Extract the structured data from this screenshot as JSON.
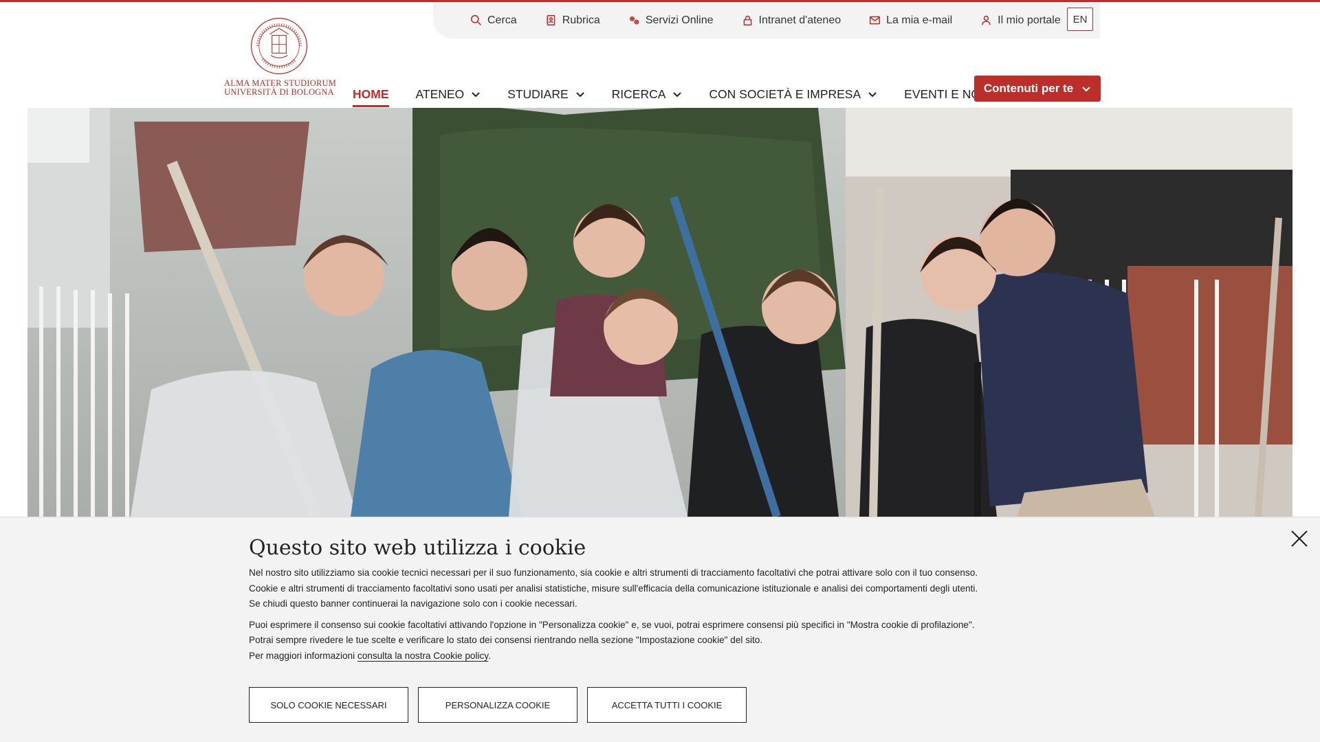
{
  "utility": {
    "search": "Cerca",
    "directory": "Rubrica",
    "online_services": "Servizi Online",
    "intranet": "Intranet d'ateneo",
    "email": "La mia e-mail",
    "portal": "Il mio portale",
    "lang": "EN"
  },
  "logo": {
    "line1": "ALMA MATER STUDIORUM",
    "line2": "UNIVERSITÀ DI BOLOGNA"
  },
  "nav": {
    "home": "HOME",
    "ateneo": "ATENEO",
    "studiare": "STUDIARE",
    "ricerca": "RICERCA",
    "societa": "CON SOCIETÀ E IMPRESA",
    "eventi": "EVENTI E NOTIZIE",
    "cta": "Contenuti per te"
  },
  "cookie": {
    "title": "Questo sito web utilizza i cookie",
    "p1": "Nel nostro sito utilizziamo sia cookie tecnici necessari per il suo funzionamento, sia cookie e altri strumenti di tracciamento facoltativi che potrai attivare solo con il tuo consenso.",
    "p2": "Cookie e altri strumenti di tracciamento facoltativi sono usati per analisi statistiche, misure sull'efficacia della comunicazione istituzionale e analisi dei comportamenti degli utenti.",
    "p3": "Se chiudi questo banner continuerai la navigazione solo con i cookie necessari.",
    "p4": "Puoi esprimere il consenso sui cookie facoltativi attivando l'opzione in \"Personalizza cookie\" e, se vuoi, potrai esprimere consensi più specifici in \"Mostra cookie di profilazione\".",
    "p5": "Potrai sempre rivedere le tue scelte e verificare lo stato dei consensi rientrando nella sezione \"Impostazione cookie\" del sito.",
    "p6_prefix": "Per maggiori informazioni ",
    "p6_link": "consulta la nostra Cookie policy",
    "p6_suffix": ".",
    "btn_necessary": "SOLO COOKIE NECESSARI",
    "btn_customize": "PERSONALIZZA COOKIE",
    "btn_accept": "ACCETTA TUTTI I COOKIE"
  },
  "colors": {
    "brand": "#bb2e29",
    "banner_bg": "#f3f3f3"
  }
}
